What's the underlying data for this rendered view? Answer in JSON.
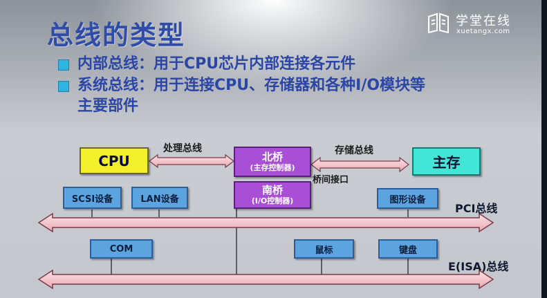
{
  "title": "总线的类型",
  "bullets": [
    {
      "text": "内部总线：用于CPU芯片内部连接各元件"
    },
    {
      "text": "系统总线：用于连接CPU、存储器和各种I/O模块等",
      "cont": "主要部件"
    }
  ],
  "logo": {
    "name": "学堂在线",
    "url": "xuetangx.com"
  },
  "diagram": {
    "cpu": "CPU",
    "memory": "主存",
    "north_bridge": {
      "name": "北桥",
      "sub": "(主存控制器)"
    },
    "south_bridge": {
      "name": "南桥",
      "sub": "(I/O控制器)"
    },
    "processing_bus": "处理总线",
    "storage_bus": "存储总线",
    "bridge_interface": "桥间接口",
    "pci_devices": [
      "SCSI设备",
      "LAN设备",
      "图形设备"
    ],
    "isa_devices": [
      "COM",
      "鼠标",
      "键盘"
    ],
    "pci_bus": "PCI总线",
    "isa_bus": "E(ISA)总线"
  },
  "colors": {
    "title": "#2f4ca8",
    "bullet": "#2fb3e0",
    "cpu": "#f2f02a",
    "memory": "#43e6d6",
    "bridge": "#a84fd6",
    "device": "#5ca4e0",
    "bus": "#f6c9cf"
  }
}
